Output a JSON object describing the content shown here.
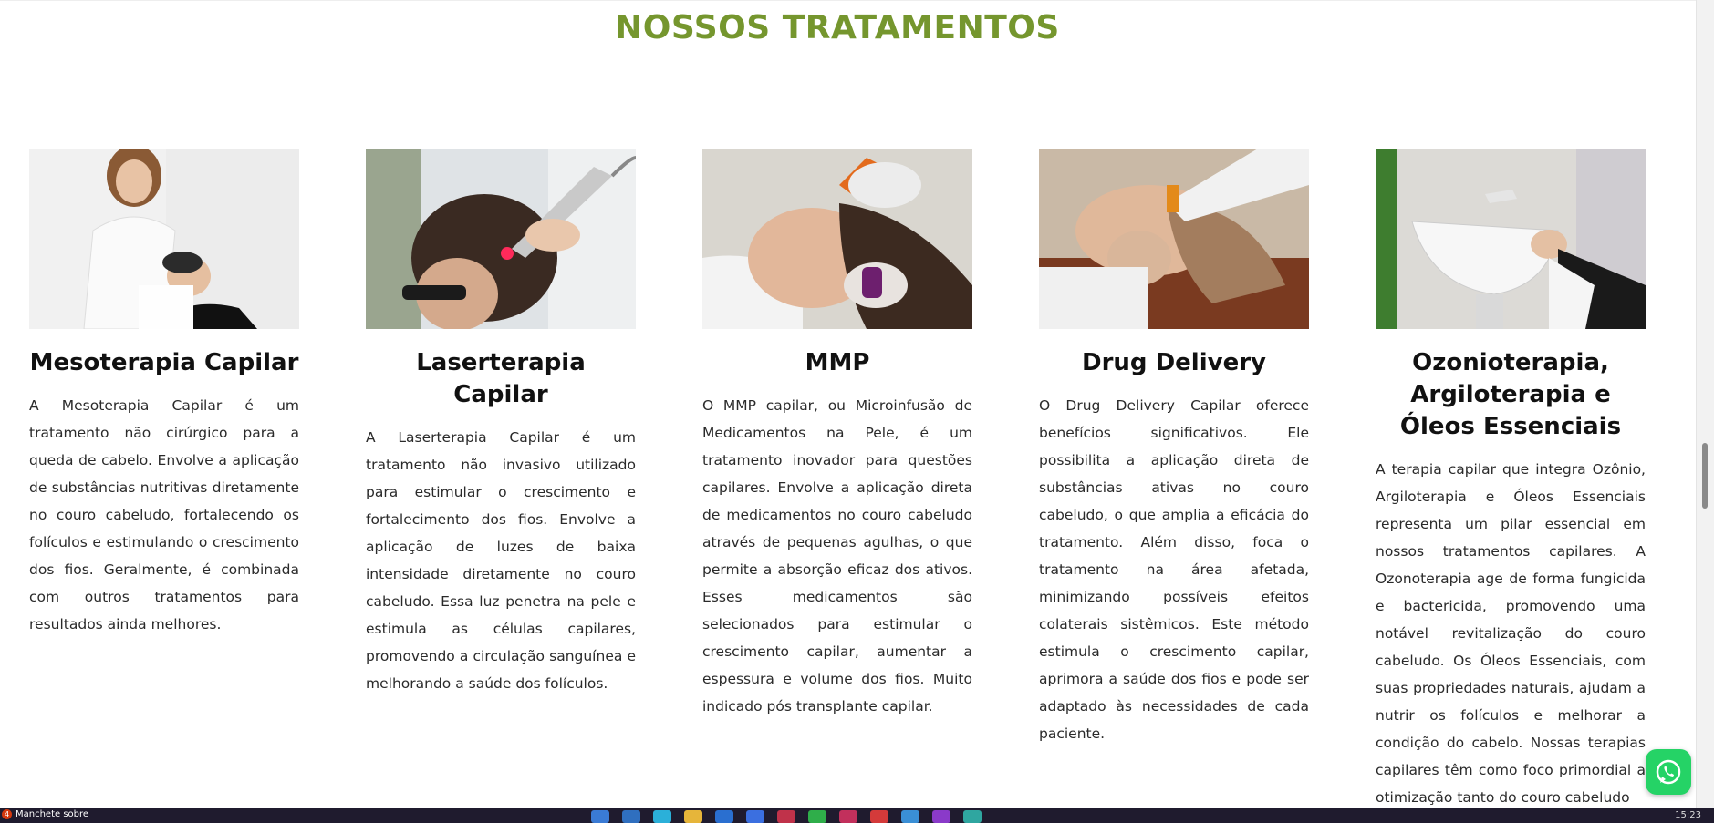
{
  "section": {
    "title": "NOSSOS TRATAMENTOS"
  },
  "cards": [
    {
      "title": "Mesoterapia Capilar",
      "text": "A Mesoterapia Capilar é um tratamento não cirúrgico para a queda de cabelo. Envolve a aplicação de substâncias nutritivas diretamente no couro cabeludo, fortalecendo os folículos e estimulando o crescimento dos fios. Geralmente, é combinada com outros tratamentos para resultados ainda melhores."
    },
    {
      "title": "Laserterapia Capilar",
      "text": "A Laserterapia Capilar é um tratamento não invasivo utilizado para estimular o crescimento e fortalecimento dos fios. Envolve a aplicação de luzes de baixa intensidade diretamente no couro cabeludo. Essa luz penetra na pele e estimula as células capilares, promovendo a circulação sanguínea e melhorando a saúde dos folículos."
    },
    {
      "title": "MMP",
      "text": "O MMP capilar, ou Microinfusão de Medicamentos na Pele, é um tratamento inovador para questões capilares. Envolve a aplicação direta de medicamentos no couro cabeludo através de pequenas agulhas, o que permite a absorção eficaz dos ativos. Esses medicamentos são selecionados para estimular o crescimento capilar, aumentar a espessura e volume dos fios. Muito indicado pós transplante capilar."
    },
    {
      "title": "Drug Delivery",
      "text": "O Drug Delivery Capilar oferece benefícios significativos. Ele possibilita a aplicação direta de substâncias ativas no couro cabeludo, o que amplia a eficácia do tratamento. Além disso, foca o tratamento na área afetada, minimizando possíveis efeitos colaterais sistêmicos. Este método estimula o crescimento capilar, aprimora a saúde dos fios e pode ser adaptado às necessidades de cada paciente."
    },
    {
      "title": "Ozonioterapia, Argiloterapia e Óleos Essenciais",
      "text": "A terapia capilar que integra Ozônio, Argiloterapia e Óleos Essenciais representa um pilar essencial em nossos tratamentos capilares. A Ozonoterapia age de forma fungicida e bactericida, promovendo uma notável revitalização do couro cabeludo. Os Óleos Essenciais, com suas propriedades naturais, ajudam a nutrir os folículos e melhorar a condição do cabelo. Nossas terapias capilares têm como foco primordial a otimização tanto do couro cabeludo"
    }
  ],
  "taskbar": {
    "news_badge": "4",
    "news_text": "Manchete sobre",
    "clock": "15:23"
  },
  "colors": {
    "accent": "#75962e",
    "whatsapp": "#25d366"
  }
}
